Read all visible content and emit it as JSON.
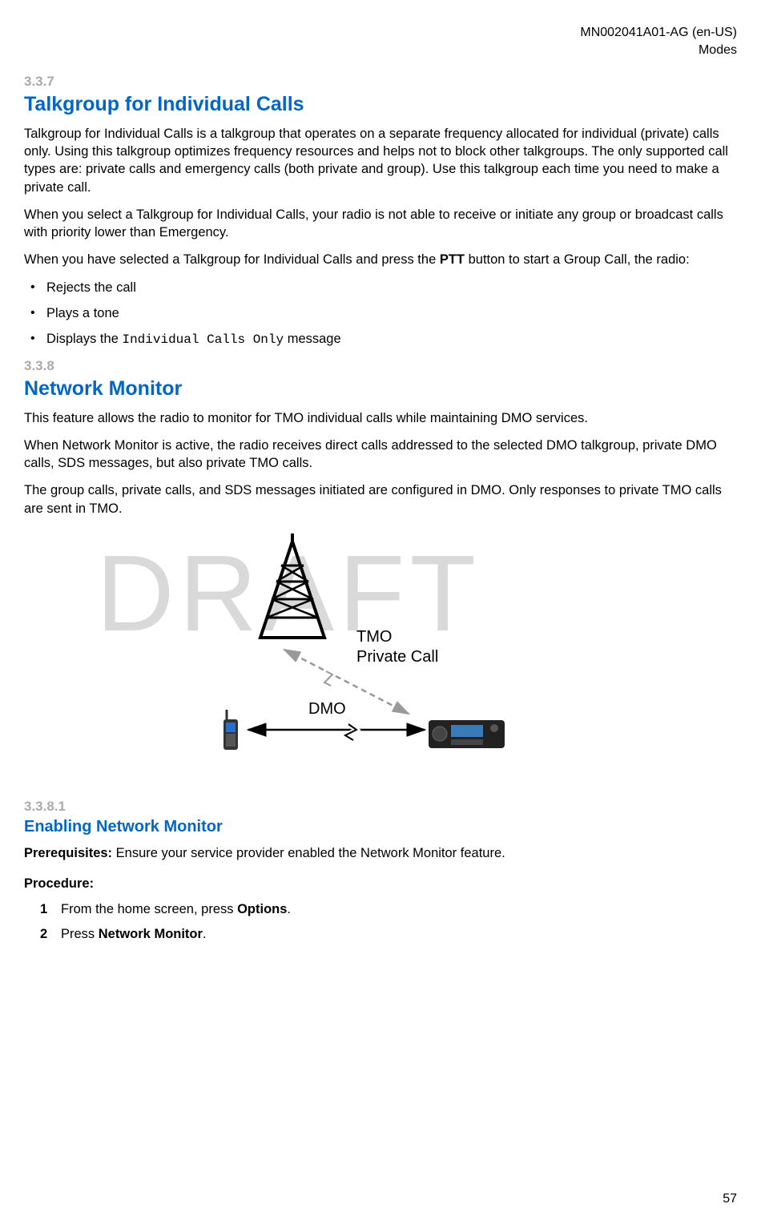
{
  "header": {
    "doc_id": "MN002041A01-AG (en-US)",
    "section_name": "Modes"
  },
  "watermark": "DRAFT",
  "sec_337": {
    "num": "3.3.7",
    "title": "Talkgroup for Individual Calls",
    "p1": "Talkgroup for Individual Calls is a talkgroup that operates on a separate frequency allocated for individual (private) calls only. Using this talkgroup optimizes frequency resources and helps not to block other talkgroups. The only supported call types are: private calls and emergency calls (both private and group). Use this talkgroup each time you need to make a private call.",
    "p2": "When you select a Talkgroup for Individual Calls, your radio is not able to receive or initiate any group or broadcast calls with priority lower than Emergency.",
    "p3_a": "When you have selected a Talkgroup for Individual Calls and press the ",
    "p3_ptt": "PTT",
    "p3_b": " button to start a Group Call, the radio:",
    "bullets": {
      "b1": "Rejects the call",
      "b2": "Plays a tone",
      "b3_a": "Displays the ",
      "b3_mono": "Individual Calls Only",
      "b3_b": " message"
    }
  },
  "sec_338": {
    "num": "3.3.8",
    "title": "Network Monitor",
    "p1": "This feature allows the radio to monitor for TMO individual calls while maintaining DMO services.",
    "p2": "When Network Monitor is active, the radio receives direct calls addressed to the selected DMO talkgroup, private DMO calls, SDS messages, but also private TMO calls.",
    "p3": "The group calls, private calls, and SDS messages initiated are configured in DMO. Only responses to private TMO calls are sent in TMO."
  },
  "diagram": {
    "tmo_label_l1": "TMO",
    "tmo_label_l2": "Private Call",
    "dmo_label": "DMO"
  },
  "sec_3381": {
    "num": "3.3.8.1",
    "title": "Enabling Network Monitor",
    "prereq_label": "Prerequisites:",
    "prereq_text": " Ensure your service provider enabled the Network Monitor feature.",
    "proc_label": "Procedure:",
    "steps": {
      "s1_a": "From the home screen, press ",
      "s1_b": "Options",
      "s1_c": ".",
      "s2_a": "Press ",
      "s2_b": "Network Monitor",
      "s2_c": "."
    }
  },
  "page_num": "57"
}
